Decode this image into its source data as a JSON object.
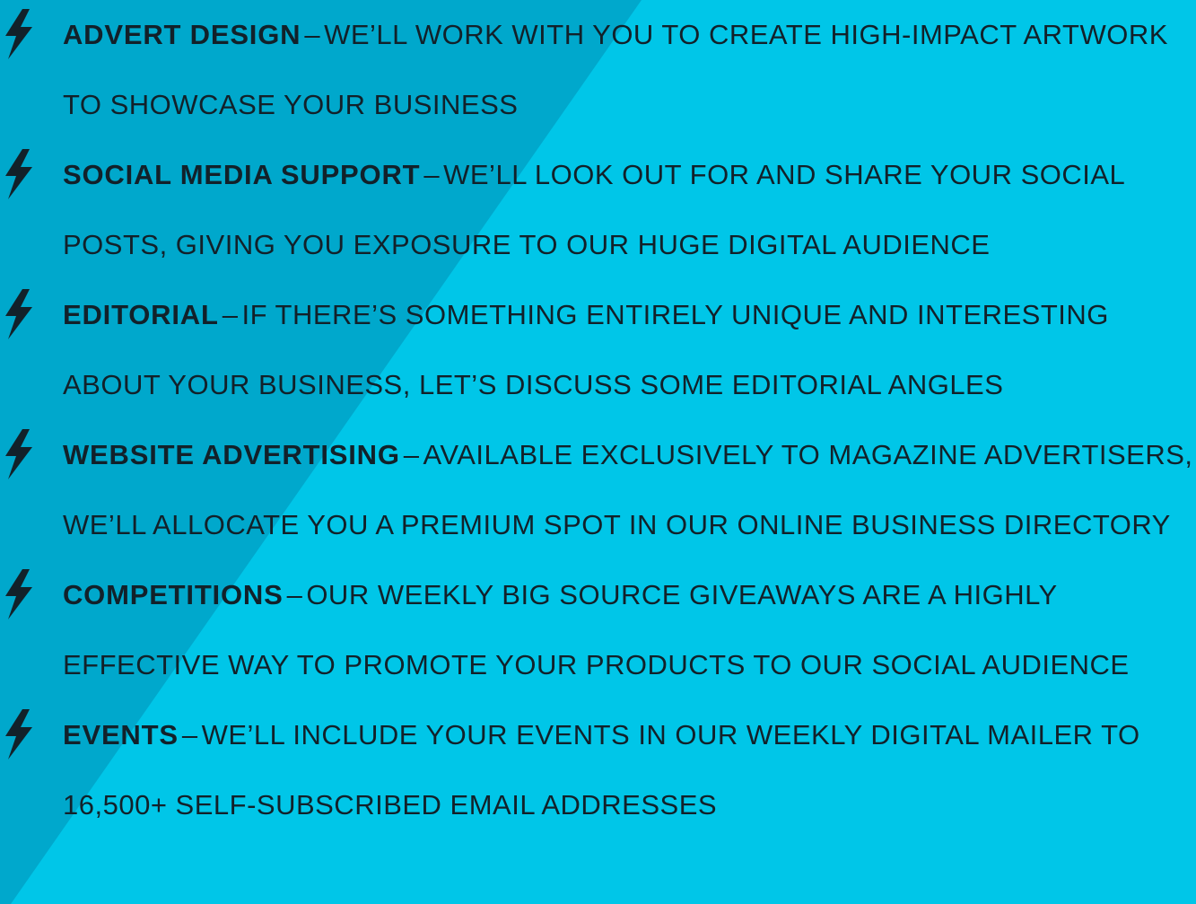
{
  "colors": {
    "background": "#00c6e8",
    "background_shade": "#00a8cc",
    "text": "#12212a",
    "icon": "#12212a"
  },
  "icon_name": "lightning-bolt-icon",
  "items": [
    {
      "title": "Advert Design",
      "separator": "–",
      "description": "we’ll work with you to create high-impact artwork to showcase your business"
    },
    {
      "title": "Social Media Support",
      "separator": "–",
      "description": "we’ll look out for and share your social posts, giving you exposure to our huge digital audience"
    },
    {
      "title": "Editorial",
      "separator": "–",
      "description": "if there’s something entirely unique and interesting about your business, let’s discuss some editorial angles"
    },
    {
      "title": "Website Advertising",
      "separator": "–",
      "description": "available exclusively to magazine advertisers, we’ll allocate you a premium spot in our online business directory"
    },
    {
      "title": "Competitions",
      "separator": "–",
      "description": "our weekly Big Source giveaways are a highly effective way to promote your products to our social audience"
    },
    {
      "title": "Events",
      "separator": "–",
      "description": "we’ll include your events in our weekly digital mailer to 16,500+ self-subscribed email addresses"
    }
  ]
}
